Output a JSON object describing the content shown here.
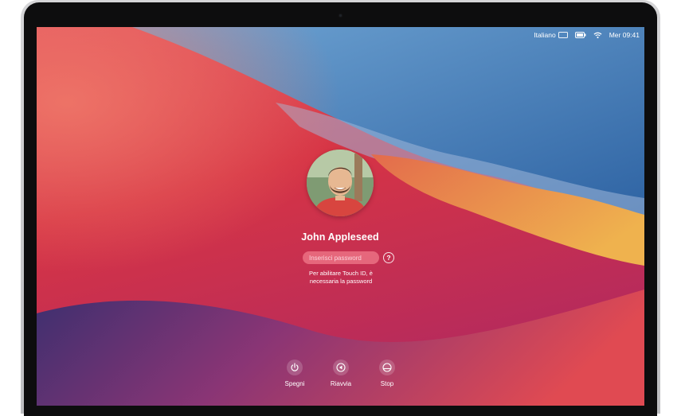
{
  "status_bar": {
    "language": "Italiano",
    "keyboard_icon": "keyboard-icon",
    "wifi_icon": "wifi-icon",
    "clock": "Mer 09:41"
  },
  "login": {
    "user_name": "John Appleseed",
    "password_placeholder": "Inserisci password",
    "help_label": "?",
    "hint_line1": "Per abilitare Touch ID, è",
    "hint_line2": "necessaria la password"
  },
  "power_actions": [
    {
      "label": "Spegni",
      "icon": "power-icon"
    },
    {
      "label": "Riavvia",
      "icon": "restart-icon"
    },
    {
      "label": "Stop",
      "icon": "sleep-icon"
    }
  ],
  "colors": {
    "wallpaper_red": "#d83a4f",
    "wallpaper_blue": "#3f79b9",
    "wallpaper_orange": "#e99444",
    "wallpaper_purple": "#7b3b86"
  }
}
